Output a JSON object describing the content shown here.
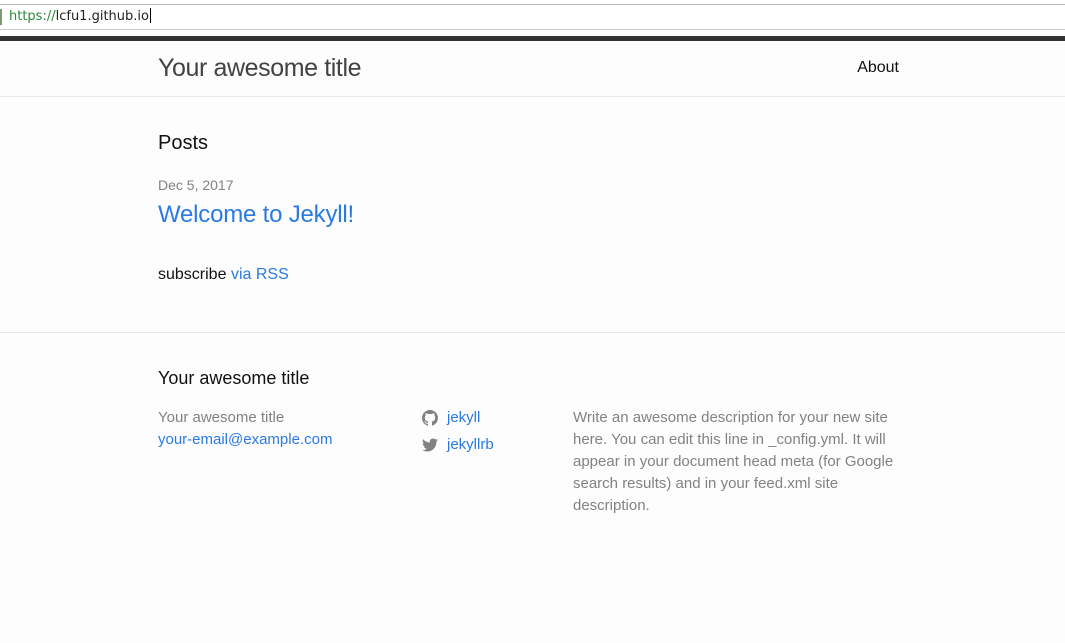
{
  "browser": {
    "url_scheme": "https://",
    "url_host": "lcfu1.github.io"
  },
  "header": {
    "site_title": "Your awesome title",
    "nav": [
      {
        "label": "About"
      }
    ]
  },
  "main": {
    "posts_heading": "Posts",
    "posts": [
      {
        "date": "Dec 5, 2017",
        "title": "Welcome to Jekyll!"
      }
    ],
    "subscribe_prefix": "subscribe",
    "subscribe_link": "via RSS"
  },
  "footer": {
    "heading": "Your awesome title",
    "name": "Your awesome title",
    "email": "your-email@example.com",
    "social": [
      {
        "icon": "github-icon",
        "label": "jekyll"
      },
      {
        "icon": "twitter-icon",
        "label": "jekyllrb"
      }
    ],
    "description": "Write an awesome description for your new site here. You can edit this line in _config.yml. It will appear in your document head meta (for Google search results) and in your feed.xml site description."
  },
  "colors": {
    "link": "#2a7ae2",
    "muted": "#828282",
    "text": "#111111",
    "title": "#424242",
    "top_rule": "#333333"
  }
}
